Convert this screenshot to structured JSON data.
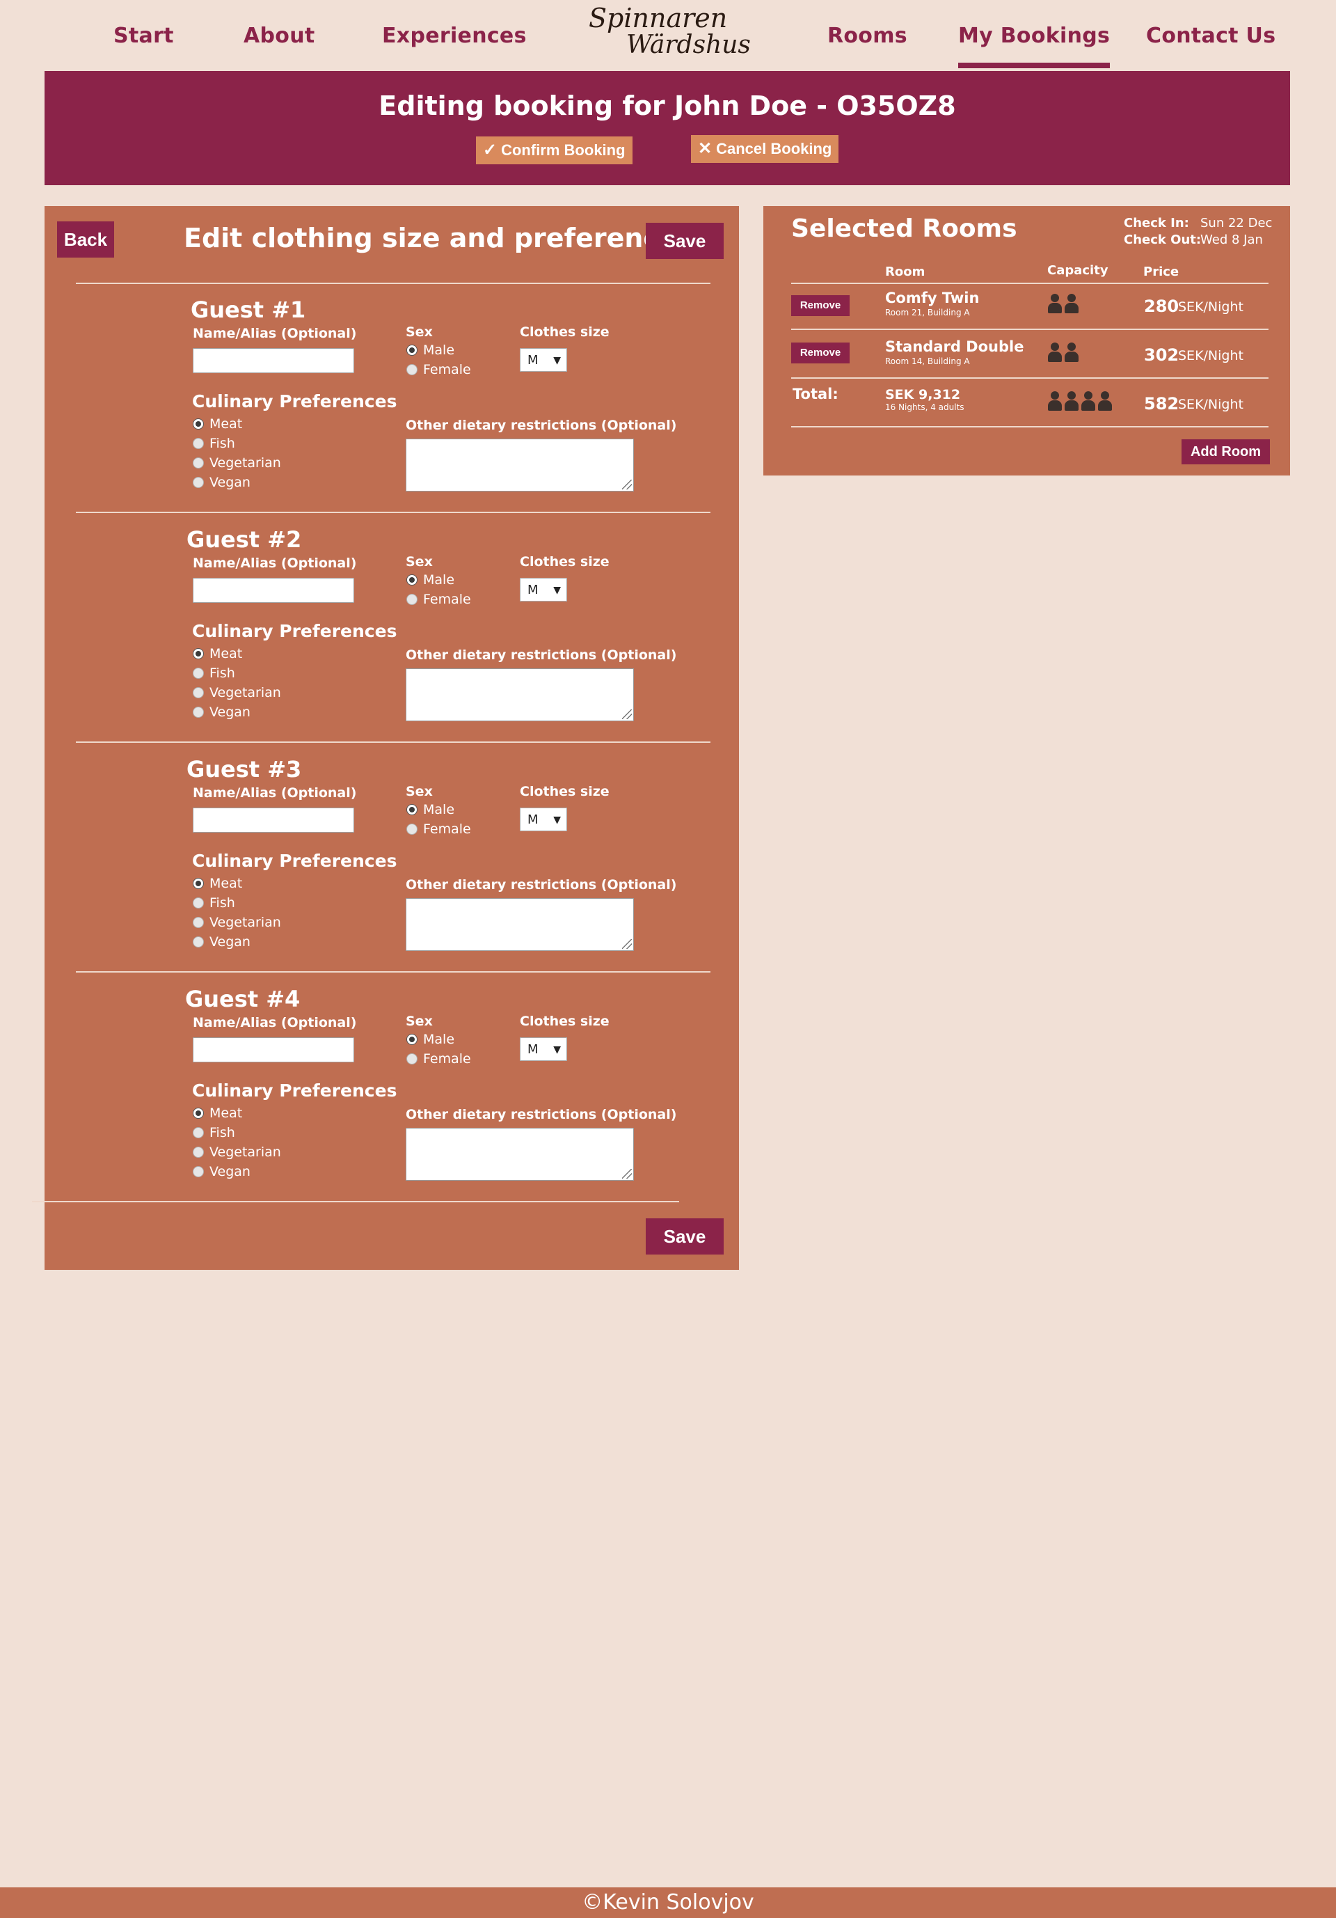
{
  "nav": {
    "items": [
      "Start",
      "About",
      "Experiences",
      "Rooms",
      "My Bookings",
      "Contact Us"
    ],
    "active": "My Bookings",
    "logo_line1": "Spinnaren",
    "logo_line2": "Wärdshus"
  },
  "banner": {
    "title": "Editing booking for John Doe - O35OZ8",
    "confirm_label": "Confirm Booking",
    "cancel_label": "Cancel Booking"
  },
  "editor": {
    "back_label": "Back",
    "title": "Edit clothing size and preferences",
    "save_label": "Save",
    "labels": {
      "name": "Name/Alias (Optional)",
      "sex": "Sex",
      "clothes": "Clothes size",
      "culinary": "Culinary Preferences",
      "dietary": "Other dietary restrictions (Optional)"
    },
    "sex_options": [
      "Male",
      "Female"
    ],
    "culinary_options": [
      "Meat",
      "Fish",
      "Vegetarian",
      "Vegan"
    ],
    "guests": [
      {
        "title": "Guest #1",
        "name": "",
        "sex": "Male",
        "clothes_size": "M",
        "culinary": "Meat",
        "dietary": ""
      },
      {
        "title": "Guest #2",
        "name": "",
        "sex": "Male",
        "clothes_size": "M",
        "culinary": "Meat",
        "dietary": ""
      },
      {
        "title": "Guest #3",
        "name": "",
        "sex": "Male",
        "clothes_size": "M",
        "culinary": "Meat",
        "dietary": ""
      },
      {
        "title": "Guest #4",
        "name": "",
        "sex": "Male",
        "clothes_size": "M",
        "culinary": "Meat",
        "dietary": ""
      }
    ]
  },
  "selected_rooms": {
    "title": "Selected Rooms",
    "check_in_label": "Check In:",
    "check_in_value": "Sun 22 Dec",
    "check_out_label": "Check Out:",
    "check_out_value": "Wed 8 Jan",
    "columns": {
      "room": "Room",
      "capacity": "Capacity",
      "price": "Price"
    },
    "remove_label": "Remove",
    "rooms": [
      {
        "name": "Comfy Twin",
        "location": "Room 21, Building A",
        "capacity": 2,
        "price": "280",
        "unit": "SEK/Night"
      },
      {
        "name": "Standard Double",
        "location": "Room 14, Building A",
        "capacity": 2,
        "price": "302",
        "unit": "SEK/Night"
      }
    ],
    "total": {
      "label": "Total:",
      "amount": "SEK 9,312",
      "detail": "16 Nights, 4 adults",
      "capacity": 4,
      "price": "582",
      "unit": "SEK/Night"
    },
    "add_room_label": "Add Room"
  },
  "footer": {
    "text": "©Kevin Solovjov"
  },
  "colors": {
    "primary": "#8b2349",
    "panel": "#bf6e51",
    "background": "#f1e0d6",
    "accent": "#d98a5c"
  }
}
